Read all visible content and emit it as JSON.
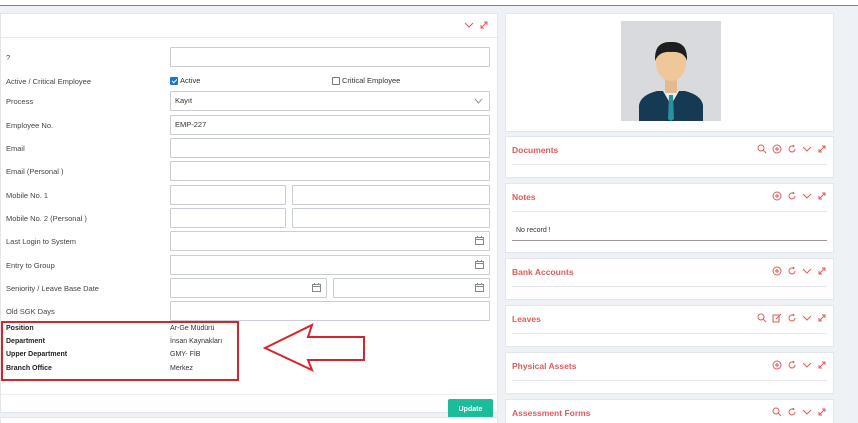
{
  "form": {
    "rows": {
      "unknown": {
        "label": "?"
      },
      "active_critical": {
        "label": "Active / Critical Employee",
        "active_label": "Active",
        "active_checked": true,
        "critical_label": "Critical Employee",
        "critical_checked": false
      },
      "process": {
        "label": "Process",
        "value": "Kayıt"
      },
      "employee_no": {
        "label": "Employee No.",
        "value": "EMP-227"
      },
      "email": {
        "label": "Email",
        "value": ""
      },
      "email_personal": {
        "label": "Email (Personal )",
        "value": ""
      },
      "mobile1": {
        "label": "Mobile No. 1"
      },
      "mobile2": {
        "label": "Mobile No. 2 (Personal )"
      },
      "last_login": {
        "label": "Last Login to System"
      },
      "entry_group": {
        "label": "Entry to Group"
      },
      "seniority": {
        "label": "Seniority / Leave Base Date"
      },
      "old_sgk": {
        "label": "Old SGK Days"
      }
    },
    "info": [
      {
        "key": "Position",
        "value": "Ar-Ge Müdürü"
      },
      {
        "key": "Department",
        "value": "İnsan Kaynakları"
      },
      {
        "key": "Upper Department",
        "value": "GMY- FİB"
      },
      {
        "key": "Branch Office",
        "value": "Merkez"
      }
    ],
    "update_label": "Update"
  },
  "cards": {
    "documents": {
      "title": "Documents"
    },
    "notes": {
      "title": "Notes",
      "empty": "No record !"
    },
    "bank_accounts": {
      "title": "Bank Accounts"
    },
    "leaves": {
      "title": "Leaves"
    },
    "physical_assets": {
      "title": "Physical Assets"
    },
    "assessment_forms": {
      "title": "Assessment Forms"
    }
  },
  "colors": {
    "accent": "#e25a5a",
    "update_button": "#1bbc9b",
    "highlight": "#d9232a",
    "checkbox": "#1e74d4"
  }
}
